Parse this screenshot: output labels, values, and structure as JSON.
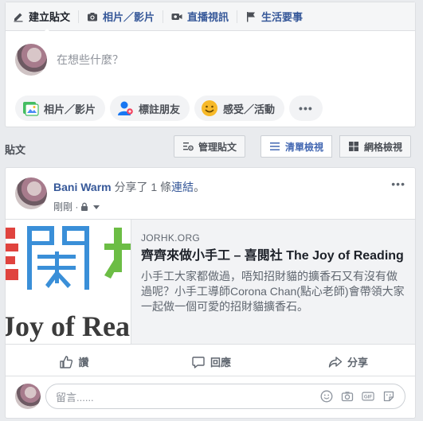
{
  "composer": {
    "tabs": [
      {
        "label": "建立貼文",
        "icon": "pencil-icon"
      },
      {
        "label": "相片／影片",
        "icon": "camera-icon"
      },
      {
        "label": "直播視訊",
        "icon": "video-icon"
      },
      {
        "label": "生活要事",
        "icon": "flag-icon"
      }
    ],
    "placeholder": "在想些什麼？",
    "pills": [
      {
        "label": "相片／影片",
        "icon": "photo-icon"
      },
      {
        "label": "標註朋友",
        "icon": "tag-friends-icon"
      },
      {
        "label": "感受／活動",
        "icon": "smiley-icon"
      },
      {
        "label": "•••",
        "icon": "more-icon"
      }
    ]
  },
  "posts_bar": {
    "label": "貼文",
    "manage": "管理貼文",
    "list_view": "清單檢視",
    "grid_view": "網格檢視"
  },
  "post": {
    "author": "Bani Warm",
    "shared_text": " 分享了 1 條",
    "link_word": "連結",
    "period": "。",
    "time": "剛剛 · ",
    "menu": "•••",
    "link_card": {
      "domain": "JORHK.ORG",
      "title": "齊齊來做小手工 – 喜閱社 The Joy of Reading",
      "description": "小手工大家都做過，唔知招財貓的擴香石又有沒有做過呢？小手工導師Corona Chan(點心老師)會帶領大家一起做一個可愛的招財貓擴香石。",
      "thumb_text_top": "喜閱社",
      "thumb_text_bottom": "Joy of Rea"
    },
    "actions": [
      "讚",
      "回應",
      "分享"
    ],
    "comment_placeholder": "留言......"
  },
  "colors": {
    "link_blue": "#365899",
    "accent_blue": "#4267b2",
    "page_bg": "#e9ebee"
  }
}
